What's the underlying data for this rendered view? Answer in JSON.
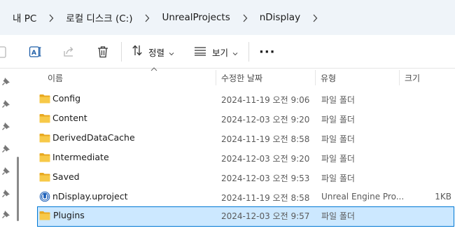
{
  "breadcrumb": {
    "items": [
      "내 PC",
      "로컬 디스크 (C:)",
      "UnrealProjects",
      "nDisplay"
    ]
  },
  "toolbar": {
    "sort_label": "정렬",
    "view_label": "보기",
    "more_label": "···"
  },
  "columns": {
    "name": "이름",
    "date": "수정한 날짜",
    "type": "유형",
    "size": "크기"
  },
  "files": [
    {
      "name": "Config",
      "date": "2024-11-19 오전 9:06",
      "type": "파일 폴더",
      "size": "",
      "icon": "folder-icon"
    },
    {
      "name": "Content",
      "date": "2024-12-03 오전 9:20",
      "type": "파일 폴더",
      "size": "",
      "icon": "folder-icon"
    },
    {
      "name": "DerivedDataCache",
      "date": "2024-11-19 오전 8:58",
      "type": "파일 폴더",
      "size": "",
      "icon": "folder-icon"
    },
    {
      "name": "Intermediate",
      "date": "2024-12-03 오전 9:20",
      "type": "파일 폴더",
      "size": "",
      "icon": "folder-icon"
    },
    {
      "name": "Saved",
      "date": "2024-12-03 오전 9:53",
      "type": "파일 폴더",
      "size": "",
      "icon": "folder-icon"
    },
    {
      "name": "nDisplay.uproject",
      "date": "2024-11-19 오전 8:58",
      "type": "Unreal Engine Pro...",
      "size": "1KB",
      "icon": "unreal-engine-icon"
    },
    {
      "name": "Plugins",
      "date": "2024-12-03 오전 9:57",
      "type": "파일 폴더",
      "size": "",
      "icon": "folder-icon",
      "selected": true
    }
  ],
  "colors": {
    "address_bg": "#eff4f9",
    "folder": "#f5c242",
    "selection_bg": "#cce8ff",
    "selection_border": "#0078d4"
  }
}
